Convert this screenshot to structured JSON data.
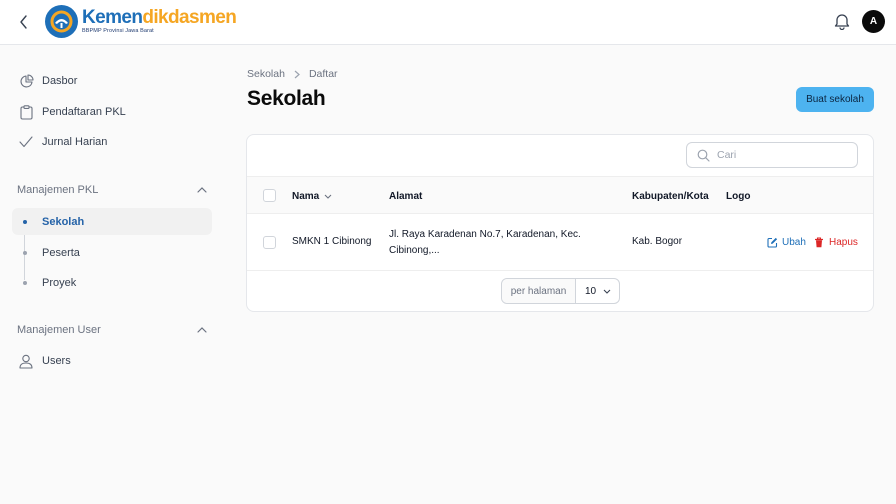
{
  "brand": {
    "name_part1": "Kemen",
    "name_part2": "dikdasmen",
    "subtitle": "BBPMP Provinsi Jawa Barat",
    "color_primary": "#1e6fb8",
    "color_secondary": "#f5a623"
  },
  "topbar": {
    "back_icon": "chevron-left-icon",
    "bell_icon": "bell-icon",
    "avatar_initial": "A"
  },
  "sidebar": {
    "items": [
      {
        "label": "Dasbor",
        "icon": "pie-chart-icon"
      },
      {
        "label": "Pendaftaran PKL",
        "icon": "clipboard-icon"
      },
      {
        "label": "Jurnal Harian",
        "icon": "check-icon"
      }
    ],
    "sections": [
      {
        "label": "Manajemen PKL",
        "items": [
          {
            "label": "Sekolah",
            "active": true
          },
          {
            "label": "Peserta",
            "active": false
          },
          {
            "label": "Proyek",
            "active": false
          }
        ]
      },
      {
        "label": "Manajemen User",
        "items": [
          {
            "label": "Users",
            "icon": "user-icon"
          }
        ]
      }
    ]
  },
  "breadcrumb": [
    "Sekolah",
    "Daftar"
  ],
  "page_title": "Sekolah",
  "create_button": "Buat sekolah",
  "search": {
    "placeholder": "Cari",
    "value": ""
  },
  "table": {
    "columns": [
      "Nama",
      "Alamat",
      "Kabupaten/Kota",
      "Logo"
    ],
    "rows": [
      {
        "nama": "SMKN 1 Cibinong",
        "alamat_line1": "Jl. Raya Karadenan No.7, Karadenan, Kec.",
        "alamat_line2": "Cibinong,...",
        "kabupaten": "Kab. Bogor",
        "edit_label": "Ubah",
        "delete_label": "Hapus"
      }
    ]
  },
  "pagination": {
    "label": "per halaman",
    "value": "10"
  },
  "colors": {
    "accent": "#4db3f0",
    "link": "#1e6fb8",
    "danger": "#dc2626"
  }
}
